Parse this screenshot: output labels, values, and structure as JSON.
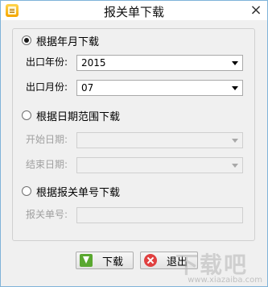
{
  "window": {
    "title": "报关单下载",
    "close_glyph": "×"
  },
  "by_month": {
    "radio_label": "根据年月下载",
    "selected": true,
    "year_label": "出口年份:",
    "year_value": "2015",
    "month_label": "出口月份:",
    "month_value": "07"
  },
  "by_range": {
    "radio_label": "根据日期范围下载",
    "selected": false,
    "start_label": "开始日期:",
    "start_value": "",
    "end_label": "结束日期:",
    "end_value": ""
  },
  "by_number": {
    "radio_label": "根据报关单号下载",
    "selected": false,
    "number_label": "报关单号:",
    "number_value": ""
  },
  "buttons": {
    "download_label": "下载",
    "exit_label": "退出"
  },
  "watermark": {
    "text": "www.xiazaiba.com"
  },
  "icons": {
    "app": "app-icon",
    "close": "close-icon",
    "download": "download-icon",
    "exit": "exit-icon"
  },
  "colors": {
    "window_border": "#7fb3d9",
    "dialog_bg": "#f0f0f0",
    "download_icon": "#5aa830",
    "exit_icon": "#e04040"
  }
}
